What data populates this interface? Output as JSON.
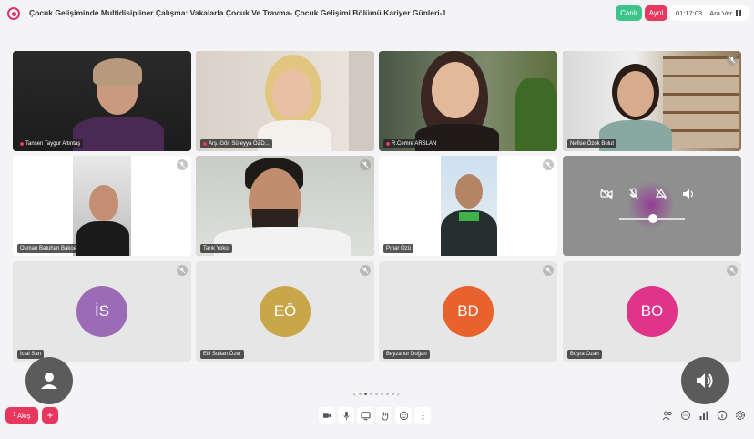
{
  "header": {
    "title": "Çocuk Gelişiminde Multidisipliner Çalışma: Vakalarla Çocuk Ve Travma- Çocuk Gelişimi Bölümü Kariyer Günleri-1",
    "live_label": "Canlı",
    "leave_label": "Ayrıl",
    "elapsed_time": "01:17:03",
    "pause_label": "Ara Ver"
  },
  "participants": [
    {
      "name": "Tansen Taygur Altıntaş",
      "type": "video",
      "muted": false
    },
    {
      "name": "Arş. Gör. Süreyya ÖZD...",
      "type": "video",
      "muted": false
    },
    {
      "name": "R.Cemre ARSLAN",
      "type": "video",
      "muted": false
    },
    {
      "name": "Nefise Özok Bulut",
      "type": "video",
      "muted": true
    },
    {
      "name": "Osman Batuhan Bakoe",
      "type": "video",
      "muted": true
    },
    {
      "name": "Tarık Yokut",
      "type": "video",
      "muted": true
    },
    {
      "name": "Pınar Özü",
      "type": "video",
      "muted": true
    },
    {
      "name": "İclal San",
      "type": "avatar",
      "initials": "İS",
      "color": "#9b6bb5",
      "muted": true
    },
    {
      "name": "Elif Sultan Özer",
      "type": "avatar",
      "initials": "EÖ",
      "color": "#c8a64a",
      "muted": true
    },
    {
      "name": "Beyzanur Doğan",
      "type": "avatar",
      "initials": "BD",
      "color": "#e8622e",
      "muted": true
    },
    {
      "name": "Büşra Ozan",
      "type": "avatar",
      "initials": "BO",
      "color": "#e0338a",
      "muted": true
    }
  ],
  "self_controls": {
    "icons": [
      "camera-off-icon",
      "mic-off-icon",
      "screen-share-off-icon",
      "speaker-icon"
    ],
    "volume_level": 0.5
  },
  "pager": {
    "pages": 7,
    "current": 1,
    "prev": "‹",
    "next": "›"
  },
  "footer": {
    "flow_label": "Akış",
    "add_label": "+",
    "toolbar_icons": [
      "camera-icon",
      "microphone-icon",
      "screen-share-icon",
      "hand-raise-icon",
      "emoji-icon",
      "more-icon"
    ],
    "right_icons": [
      "participants-icon",
      "chat-icon",
      "stats-icon",
      "info-icon",
      "settings-icon"
    ]
  }
}
